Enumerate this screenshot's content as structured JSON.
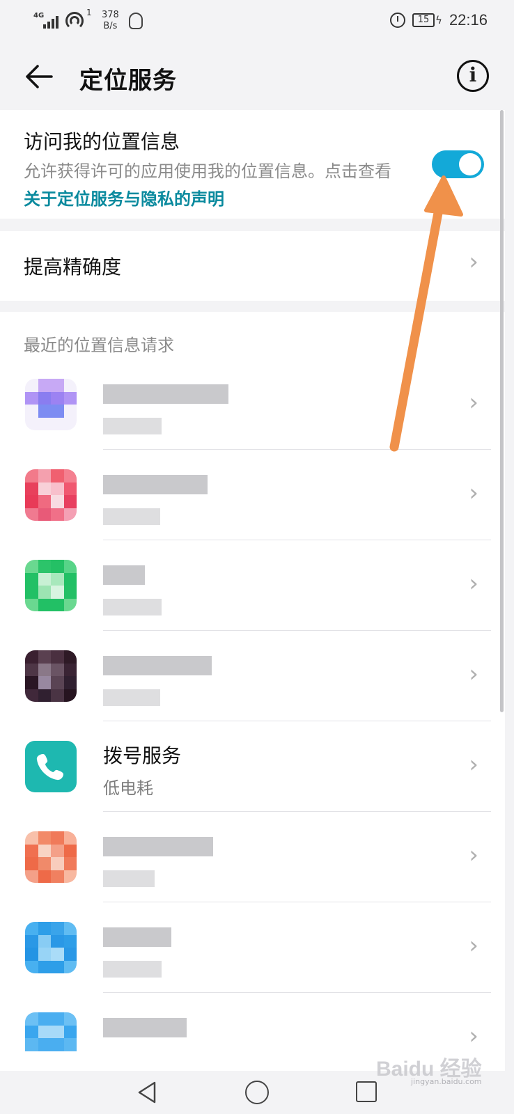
{
  "status_bar": {
    "network_tag": "4G",
    "hotspot_count": "1",
    "speed_value": "378",
    "speed_unit": "B/s",
    "battery": "15",
    "time": "22:16",
    "icons": [
      "signal-icon",
      "hotspot-icon",
      "qq-icon",
      "alarm-icon",
      "battery-icon",
      "charging-icon"
    ]
  },
  "header": {
    "title": "定位服务",
    "info_glyph": "i"
  },
  "location_access": {
    "title": "访问我的位置信息",
    "description": "允许获得许可的应用使用我的位置信息。点击查看",
    "link_text": "关于定位服务与隐私的声明",
    "enabled": true,
    "accent_color": "#13a9d8"
  },
  "accuracy": {
    "label": "提高精确度"
  },
  "recent_requests": {
    "section_title": "最近的位置信息请求",
    "items": [
      {
        "name": "",
        "sub": "",
        "blurred": true,
        "icon_color": "#8a7df0"
      },
      {
        "name": "",
        "sub": "",
        "blurred": true,
        "icon_color": "#f0506e"
      },
      {
        "name": "",
        "sub": "",
        "blurred": true,
        "icon_color": "#22c065"
      },
      {
        "name": "",
        "sub": "",
        "blurred": true,
        "icon_color": "#4a3040"
      },
      {
        "name": "拨号服务",
        "sub": "低电耗",
        "blurred": false,
        "icon_color": "#1eb8b0"
      },
      {
        "name": "",
        "sub": "",
        "blurred": true,
        "icon_color": "#f07a5a"
      },
      {
        "name": "",
        "sub": "",
        "blurred": true,
        "icon_color": "#2e9ee8"
      },
      {
        "name": "",
        "sub": "",
        "blurred": true,
        "icon_color": "#4aaef0"
      }
    ]
  },
  "annotation": {
    "arrow_color": "#f0914a"
  },
  "watermark": {
    "brand": "Baidu 经验",
    "url": "jingyan.baidu.com"
  }
}
